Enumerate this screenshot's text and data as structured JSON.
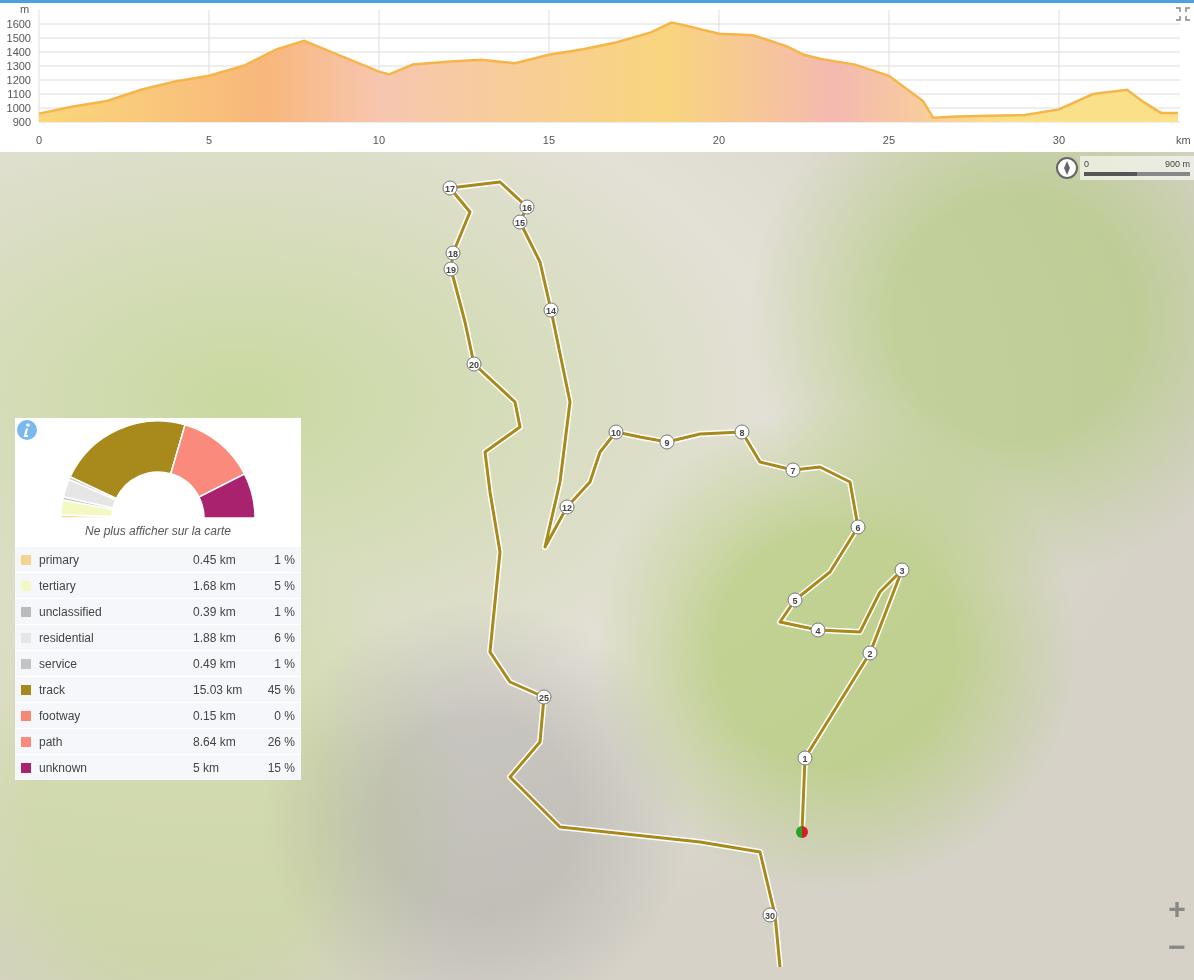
{
  "elevation_profile": {
    "chart_data": {
      "type": "area",
      "xlabel": "km",
      "ylabel": "m",
      "x": [
        0,
        1,
        2,
        3,
        4,
        5,
        6,
        7,
        7.8,
        9,
        10,
        10.3,
        11,
        12,
        13,
        14,
        15,
        16,
        17,
        18,
        18.6,
        19,
        20,
        21,
        22,
        22.5,
        23,
        24,
        25,
        26,
        26.3,
        27,
        28,
        29,
        30,
        31,
        32,
        32.5,
        33,
        33.5
      ],
      "series": [
        {
          "color": "#f5b548",
          "values": [
            960,
            1010,
            1050,
            1130,
            1190,
            1230,
            1300,
            1420,
            1480,
            1360,
            1260,
            1240,
            1310,
            1330,
            1345,
            1320,
            1380,
            1420,
            1470,
            1540,
            1610,
            1590,
            1530,
            1520,
            1440,
            1380,
            1350,
            1310,
            1230,
            1050,
            930,
            940,
            945,
            950,
            990,
            1100,
            1130,
            1040,
            965,
            965
          ]
        }
      ],
      "xlim": [
        0,
        33.56
      ],
      "ylim": [
        900,
        1700
      ],
      "grid": true,
      "xticks": [
        0,
        5,
        10,
        15,
        20,
        25,
        30
      ],
      "yticks": [
        900,
        1000,
        1100,
        1200,
        1300,
        1400,
        1500,
        1600
      ]
    }
  },
  "map": {
    "km_markers": [
      "1",
      "2",
      "3",
      "4",
      "5",
      "6",
      "7",
      "8",
      "9",
      "10",
      "12",
      "14",
      "15",
      "16",
      "17",
      "18",
      "19",
      "20",
      "25",
      "30"
    ],
    "scale": {
      "start": "0",
      "end": "900 m"
    },
    "zoom_in": "+",
    "zoom_out": "−"
  },
  "surface_panel": {
    "chart_data": {
      "type": "donut",
      "categories": [
        "primary",
        "tertiary",
        "unclassified",
        "residential",
        "service",
        "track",
        "footway",
        "path",
        "unknown"
      ],
      "series": [
        {
          "values": [
            1,
            5,
            1,
            6,
            1,
            45,
            0,
            26,
            15
          ]
        }
      ]
    },
    "hide_link": "Ne plus afficher sur la carte",
    "legend": [
      {
        "distance": "0.45 km",
        "percent": "1 %",
        "color": "#f7d390"
      },
      {
        "distance": "1.68 km",
        "percent": "5 %",
        "color": "#f4f9c4"
      },
      {
        "distance": "0.39 km",
        "percent": "1 %",
        "color": "#bcbcbc"
      },
      {
        "distance": "1.88 km",
        "percent": "6 %",
        "color": "#e6e6e6"
      },
      {
        "distance": "0.49 km",
        "percent": "1 %",
        "color": "#c4c4c4"
      },
      {
        "distance": "15.03 km",
        "percent": "45 %",
        "color": "#a8891b"
      },
      {
        "distance": "0.15 km",
        "percent": "0 %",
        "color": "#f98873"
      },
      {
        "distance": "8.64 km",
        "percent": "26 %",
        "color": "#f98a7c"
      },
      {
        "distance": "5 km",
        "percent": "15 %",
        "color": "#a8226e"
      }
    ]
  }
}
